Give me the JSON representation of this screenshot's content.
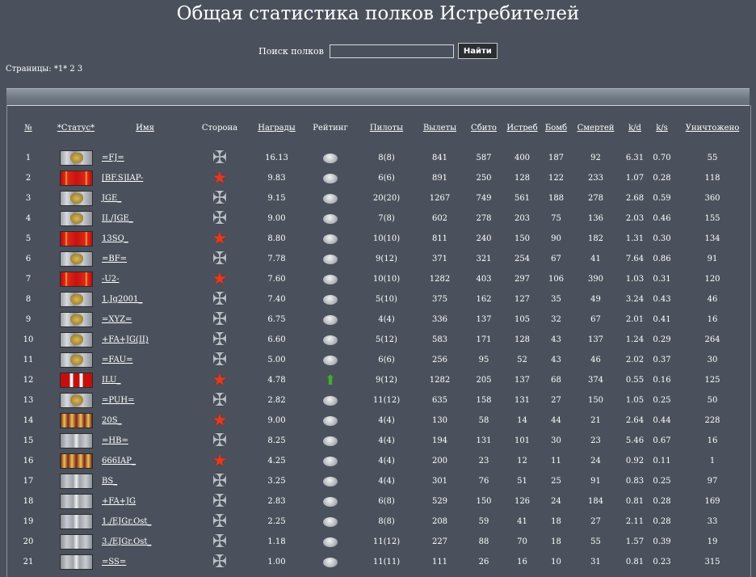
{
  "page": {
    "title": "Общая статистика полков Истребителей",
    "search_label": "Поиск полков",
    "search_value": "",
    "search_button": "Найти",
    "pages_text": "Страницы: *1* 2 3"
  },
  "columns": {
    "num": "№",
    "status": "*Статус*",
    "name": "Имя",
    "side": "Сторона",
    "awards": "Награды",
    "rating": "Рейтинг",
    "pilots": "Пилоты",
    "sorties": "Вылеты",
    "shot": "Сбито",
    "fighters": "Истреб",
    "bombers": "Бомб",
    "deaths": "Смертей",
    "kd": "k/d",
    "ks": "k/s",
    "destroyed": "Уничтожено"
  },
  "rows": [
    {
      "num": "1",
      "medal": "eagle",
      "name": "=FJ=",
      "side": "cross",
      "awards": "16.13",
      "rating": "oval",
      "pilots": "8(8)",
      "sorties": "841",
      "shot": "587",
      "fighters": "400",
      "bombers": "187",
      "deaths": "92",
      "kd": "6.31",
      "ks": "0.70",
      "destroyed": "55"
    },
    {
      "num": "2",
      "medal": "red",
      "name": "[BF.S]IAP-",
      "side": "star",
      "awards": "9.83",
      "rating": "oval",
      "pilots": "6(6)",
      "sorties": "891",
      "shot": "250",
      "fighters": "128",
      "bombers": "122",
      "deaths": "233",
      "kd": "1.07",
      "ks": "0.28",
      "destroyed": "118"
    },
    {
      "num": "3",
      "medal": "eagle",
      "name": "JGE_",
      "side": "cross",
      "awards": "9.15",
      "rating": "oval",
      "pilots": "20(20)",
      "sorties": "1267",
      "shot": "749",
      "fighters": "561",
      "bombers": "188",
      "deaths": "278",
      "kd": "2.68",
      "ks": "0.59",
      "destroyed": "360"
    },
    {
      "num": "4",
      "medal": "eagle",
      "name": "II./JGE_",
      "side": "cross",
      "awards": "9.00",
      "rating": "oval",
      "pilots": "7(8)",
      "sorties": "602",
      "shot": "278",
      "fighters": "203",
      "bombers": "75",
      "deaths": "136",
      "kd": "2.03",
      "ks": "0.46",
      "destroyed": "155"
    },
    {
      "num": "5",
      "medal": "red",
      "name": "13SQ_",
      "side": "star",
      "awards": "8.80",
      "rating": "oval",
      "pilots": "10(10)",
      "sorties": "811",
      "shot": "240",
      "fighters": "150",
      "bombers": "90",
      "deaths": "182",
      "kd": "1.31",
      "ks": "0.30",
      "destroyed": "134"
    },
    {
      "num": "6",
      "medal": "eagle",
      "name": "=BF=",
      "side": "cross",
      "awards": "7.78",
      "rating": "oval",
      "pilots": "9(12)",
      "sorties": "371",
      "shot": "321",
      "fighters": "254",
      "bombers": "67",
      "deaths": "41",
      "kd": "7.64",
      "ks": "0.86",
      "destroyed": "91"
    },
    {
      "num": "7",
      "medal": "red",
      "name": "-U2-",
      "side": "star",
      "awards": "7.60",
      "rating": "oval",
      "pilots": "10(10)",
      "sorties": "1282",
      "shot": "403",
      "fighters": "297",
      "bombers": "106",
      "deaths": "390",
      "kd": "1.03",
      "ks": "0.31",
      "destroyed": "120"
    },
    {
      "num": "8",
      "medal": "eagle",
      "name": "1.Jg2001_",
      "side": "cross",
      "awards": "7.40",
      "rating": "oval",
      "pilots": "5(10)",
      "sorties": "375",
      "shot": "162",
      "fighters": "127",
      "bombers": "35",
      "deaths": "49",
      "kd": "3.24",
      "ks": "0.43",
      "destroyed": "46"
    },
    {
      "num": "9",
      "medal": "eagle",
      "name": "=XYZ=",
      "side": "cross",
      "awards": "6.75",
      "rating": "oval",
      "pilots": "4(4)",
      "sorties": "336",
      "shot": "137",
      "fighters": "105",
      "bombers": "32",
      "deaths": "67",
      "kd": "2.01",
      "ks": "0.41",
      "destroyed": "16"
    },
    {
      "num": "10",
      "medal": "eagle",
      "name": "+FA+JG(II)",
      "side": "cross",
      "awards": "6.60",
      "rating": "oval",
      "pilots": "5(12)",
      "sorties": "583",
      "shot": "171",
      "fighters": "128",
      "bombers": "43",
      "deaths": "137",
      "kd": "1.24",
      "ks": "0.29",
      "destroyed": "264"
    },
    {
      "num": "11",
      "medal": "eagle",
      "name": "=FAU=",
      "side": "cross",
      "awards": "5.00",
      "rating": "oval",
      "pilots": "6(6)",
      "sorties": "256",
      "shot": "95",
      "fighters": "52",
      "bombers": "43",
      "deaths": "46",
      "kd": "2.02",
      "ks": "0.37",
      "destroyed": "30"
    },
    {
      "num": "12",
      "medal": "redwhite",
      "name": "ILU_",
      "side": "star",
      "awards": "4.78",
      "rating": "up",
      "pilots": "9(12)",
      "sorties": "1282",
      "shot": "205",
      "fighters": "137",
      "bombers": "68",
      "deaths": "374",
      "kd": "0.55",
      "ks": "0.16",
      "destroyed": "125"
    },
    {
      "num": "13",
      "medal": "eagle",
      "name": "=PUH=",
      "side": "cross",
      "awards": "2.82",
      "rating": "oval",
      "pilots": "11(12)",
      "sorties": "635",
      "shot": "158",
      "fighters": "131",
      "bombers": "27",
      "deaths": "150",
      "kd": "1.05",
      "ks": "0.25",
      "destroyed": "50"
    },
    {
      "num": "14",
      "medal": "brown",
      "name": "20S_",
      "side": "star",
      "awards": "9.00",
      "rating": "oval",
      "pilots": "4(4)",
      "sorties": "130",
      "shot": "58",
      "fighters": "14",
      "bombers": "44",
      "deaths": "21",
      "kd": "2.64",
      "ks": "0.44",
      "destroyed": "228"
    },
    {
      "num": "15",
      "medal": "grey",
      "name": "=HB=",
      "side": "cross",
      "awards": "8.25",
      "rating": "oval",
      "pilots": "4(4)",
      "sorties": "194",
      "shot": "131",
      "fighters": "101",
      "bombers": "30",
      "deaths": "23",
      "kd": "5.46",
      "ks": "0.67",
      "destroyed": "16"
    },
    {
      "num": "16",
      "medal": "brown",
      "name": "666IAP_",
      "side": "star",
      "awards": "4.25",
      "rating": "oval",
      "pilots": "4(4)",
      "sorties": "200",
      "shot": "23",
      "fighters": "12",
      "bombers": "11",
      "deaths": "24",
      "kd": "0.92",
      "ks": "0.11",
      "destroyed": "1"
    },
    {
      "num": "17",
      "medal": "grey",
      "name": "BS_",
      "side": "cross",
      "awards": "3.25",
      "rating": "oval",
      "pilots": "4(4)",
      "sorties": "301",
      "shot": "76",
      "fighters": "51",
      "bombers": "25",
      "deaths": "91",
      "kd": "0.83",
      "ks": "0.25",
      "destroyed": "97"
    },
    {
      "num": "18",
      "medal": "grey",
      "name": "+FA+JG",
      "side": "cross",
      "awards": "2.83",
      "rating": "oval",
      "pilots": "6(8)",
      "sorties": "529",
      "shot": "150",
      "fighters": "126",
      "bombers": "24",
      "deaths": "184",
      "kd": "0.81",
      "ks": "0.28",
      "destroyed": "169"
    },
    {
      "num": "19",
      "medal": "grey",
      "name": "1./EJGr.Ost_",
      "side": "cross",
      "awards": "2.25",
      "rating": "oval",
      "pilots": "8(8)",
      "sorties": "208",
      "shot": "59",
      "fighters": "41",
      "bombers": "18",
      "deaths": "27",
      "kd": "2.11",
      "ks": "0.28",
      "destroyed": "33"
    },
    {
      "num": "20",
      "medal": "grey",
      "name": "3./EJGr.Ost_",
      "side": "cross",
      "awards": "1.18",
      "rating": "oval",
      "pilots": "11(12)",
      "sorties": "227",
      "shot": "88",
      "fighters": "70",
      "bombers": "18",
      "deaths": "55",
      "kd": "1.57",
      "ks": "0.39",
      "destroyed": "19"
    },
    {
      "num": "21",
      "medal": "grey",
      "name": "=SS=",
      "side": "cross",
      "awards": "1.00",
      "rating": "oval",
      "pilots": "11(11)",
      "sorties": "111",
      "shot": "26",
      "fighters": "16",
      "bombers": "10",
      "deaths": "31",
      "kd": "0.81",
      "ks": "0.23",
      "destroyed": "315"
    }
  ]
}
